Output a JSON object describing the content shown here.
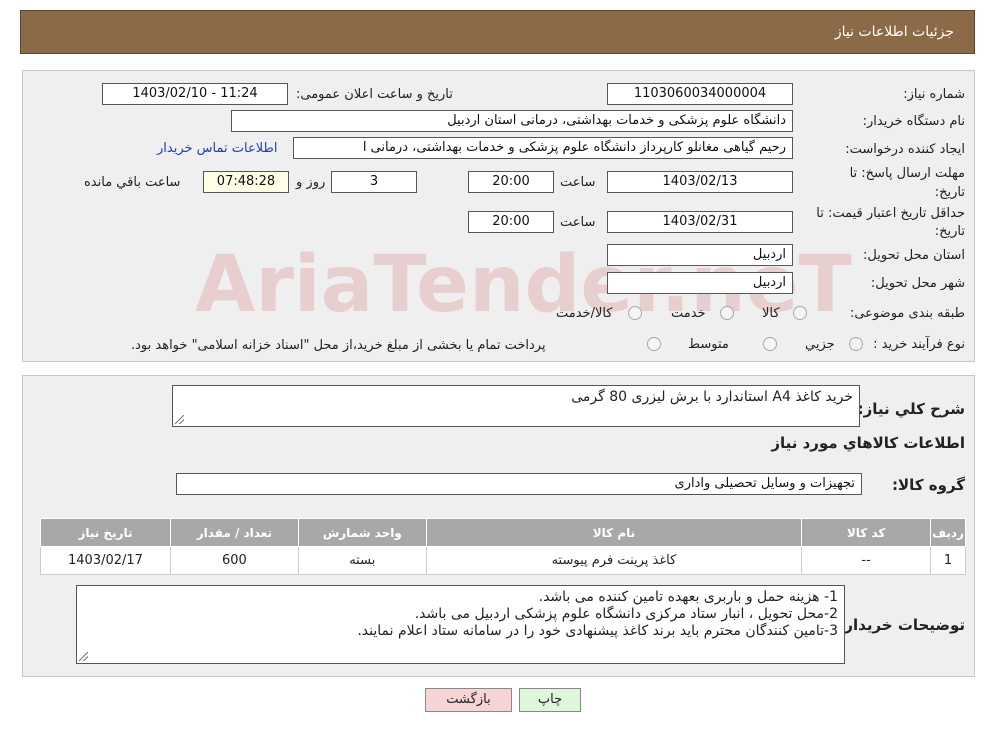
{
  "header": {
    "title": "جزئیات اطلاعات نیاز"
  },
  "form": {
    "need_number_label": "شماره نیاز:",
    "need_number": "1103060034000004",
    "announce_label": "تاریخ و ساعت اعلان عمومی:",
    "announce_value": "1403/02/10 - 11:24",
    "buyer_org_label": "نام دستگاه خریدار:",
    "buyer_org": "دانشگاه علوم پزشکی و خدمات بهداشتی، درمانی استان اردبیل",
    "creator_label": "ایجاد کننده درخواست:",
    "creator": "رحیم گیاهی مغانلو کارپرداز دانشگاه علوم پزشکی و خدمات بهداشتی، درمانی ا",
    "contact_link": "اطلاعات تماس خریدار",
    "deadline_label_1": "مهلت ارسال پاسخ: تا",
    "deadline_label_2": "تاریخ:",
    "deadline_date": "1403/02/13",
    "time_label": "ساعت",
    "deadline_time": "20:00",
    "days_value": "3",
    "days_label": "روز و",
    "remaining_time": "07:48:28",
    "remaining_label": "ساعت باقي مانده",
    "validity_label_1": "حداقل تاریخ اعتبار قیمت: تا",
    "validity_label_2": "تاریخ:",
    "validity_date": "1403/02/31",
    "validity_time": "20:00",
    "province_label": "استان محل تحویل:",
    "province": "اردبیل",
    "city_label": "شهر محل تحویل:",
    "city": "اردبیل",
    "category_label": "طبقه بندی موضوعی:",
    "category_options": [
      "کالا",
      "خدمت",
      "کالا/خدمت"
    ],
    "process_label": "نوع فرآیند خرید :",
    "process_options": [
      "جزيي",
      "متوسط"
    ],
    "process_note": "پرداخت تمام یا بخشی از مبلغ خرید،از محل \"اسناد خزانه اسلامی\" خواهد بود."
  },
  "details": {
    "desc_label": "شرح کلي نياز:",
    "desc_value": "خرید کاغذ A4 استاندارد با برش لیزری 80 گرمی",
    "goods_info_title": "اطلاعات کالاهاي مورد نياز",
    "group_label": "گروه کالا:",
    "group_value": "تجهیزات و وسایل تحصیلی واداری",
    "table": {
      "headers": [
        "ردیف",
        "کد کالا",
        "نام کالا",
        "واحد شمارش",
        "تعداد / مقدار",
        "تاریخ نیاز"
      ],
      "rows": [
        [
          "1",
          "--",
          "کاغذ پرینت فرم پیوسته",
          "بسته",
          "600",
          "1403/02/17"
        ]
      ]
    },
    "buyer_notes_label": "توضیحات خریدار:",
    "buyer_notes": [
      "1- هزینه حمل و باربری بعهده تامین کننده می باشد.",
      "2-محل تحویل ، انبار ستاد مرکزی دانشگاه علوم پزشکی اردبیل می باشد.",
      "3-تامین کنندگان محترم باید برند کاغذ پیشنهادی خود را در سامانه ستاد اعلام نمایند."
    ]
  },
  "buttons": {
    "print": "چاپ",
    "back": "بازگشت"
  },
  "watermark": "AriaTender.neT",
  "colors": {
    "header": "#8a6a47",
    "table_header": "#a8a8a8",
    "back_button": "#f6d4d4",
    "print_button": "#dff5dc",
    "link": "#1f3fbf"
  }
}
